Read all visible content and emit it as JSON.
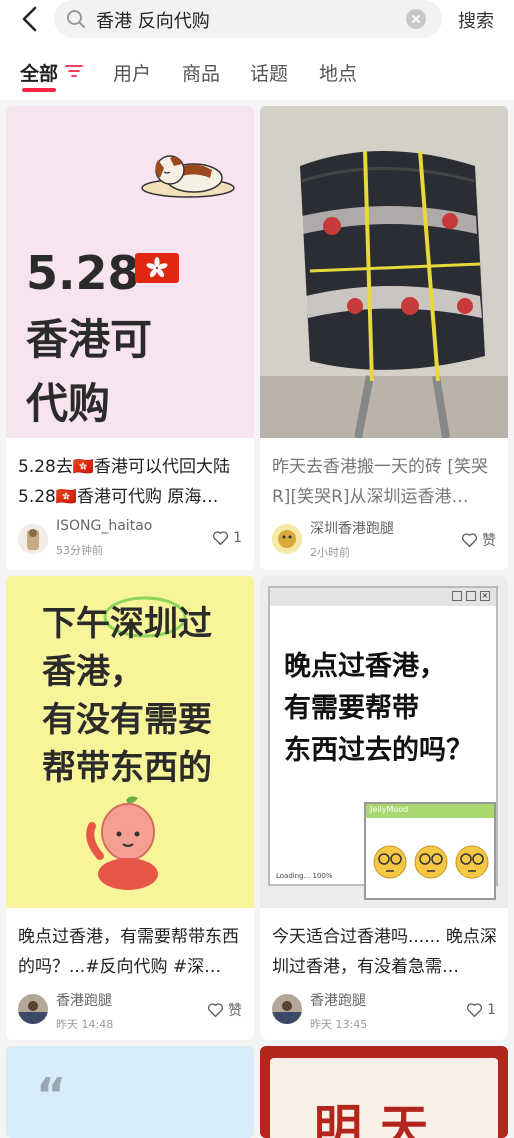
{
  "search": {
    "query": "香港 反向代购",
    "submit_label": "搜索"
  },
  "tabs": [
    {
      "label": "全部"
    },
    {
      "label": "用户"
    },
    {
      "label": "商品"
    },
    {
      "label": "话题"
    },
    {
      "label": "地点"
    }
  ],
  "cards": [
    {
      "cover_lines": [
        "5.28",
        "香港可",
        "代购"
      ],
      "title": "5.28去🇭🇰香港可以代回大陆 5.28🇭🇰香港可代购 原海…",
      "user": "ISONG_haitao",
      "time": "53分钟前",
      "likes": "1"
    },
    {
      "title": "昨天去香港搬一天的砖 [笑哭R][笑哭R]从深圳运香港…",
      "user": "深圳香港跑腿",
      "time": "2小时前",
      "likes": "赞"
    },
    {
      "cover_lines": [
        "下午深圳过",
        "香港，",
        "有没有需要",
        "帮带东西的"
      ],
      "title": "晚点过香港，有需要帮带东西的吗？...#反向代购 #深…",
      "user": "香港跑腿",
      "time": "昨天 14:48",
      "likes": "赞"
    },
    {
      "cover_lines": [
        "晚点过香港，",
        "有需要帮带",
        "东西过去的吗？"
      ],
      "cover_small": {
        "window_title": "JellyMood",
        "loading": "Loading... 100%"
      },
      "title": "今天适合过香港吗...... 晚点深圳过香港，有没着急需…",
      "user": "香港跑腿",
      "time": "昨天 13:45",
      "likes": "1"
    },
    {
      "cover_lines": [
        "“"
      ]
    },
    {
      "cover_lines": [
        "明天"
      ]
    }
  ],
  "colors": {
    "accent": "#ff2442",
    "card1_bg": "#f7e4f0",
    "card3_bg": "#f8f49a",
    "card5_bg": "#d6ecf8",
    "card6_bg": "#b3261e"
  },
  "icons": [
    "back-arrow-icon",
    "search-icon",
    "clear-icon",
    "filter-icon",
    "heart-icon",
    "hk-flag-icon"
  ]
}
